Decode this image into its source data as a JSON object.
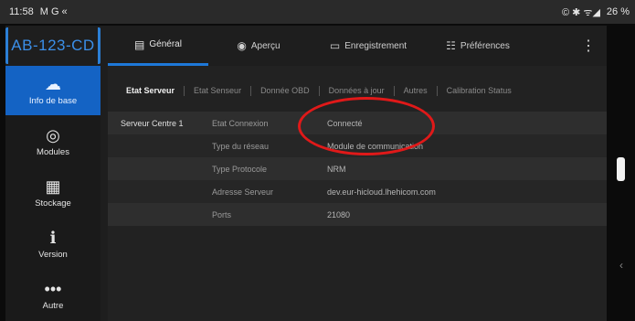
{
  "status_bar": {
    "time": "11:58",
    "left_icons": "M G «",
    "right_icons": "© ✱ ᯤ◢",
    "battery": "26 %"
  },
  "device_id": "AB-123-CD",
  "tabs": [
    {
      "icon": "▤",
      "label": "Général",
      "active": true
    },
    {
      "icon": "◉",
      "label": "Aperçu",
      "active": false
    },
    {
      "icon": "▭",
      "label": "Enregistrement",
      "active": false
    },
    {
      "icon": "☷",
      "label": "Préférences",
      "active": false
    }
  ],
  "menu_icon": "⋮",
  "sidebar": [
    {
      "icon": "☁",
      "label": "Info de base",
      "active": true
    },
    {
      "icon": "◎",
      "label": "Modules",
      "active": false
    },
    {
      "icon": "▦",
      "label": "Stockage",
      "active": false
    },
    {
      "icon": "ℹ",
      "label": "Version",
      "active": false
    },
    {
      "icon": "•••",
      "label": "Autre",
      "active": false
    }
  ],
  "subtabs": [
    "Etat Serveur",
    "Etat Senseur",
    "Donnée OBD",
    "Données à jour",
    "Autres",
    "Calibration Status"
  ],
  "server": {
    "name": "Serveur Centre 1",
    "rows": [
      {
        "label": "Etat Connexion",
        "value": "Connecté"
      },
      {
        "label": "Type du réseau",
        "value": "Module de communication"
      },
      {
        "label": "Type Protocole",
        "value": "NRM"
      },
      {
        "label": "Adresse Serveur",
        "value": "dev.eur-hicloud.lhehicom.com"
      },
      {
        "label": "Ports",
        "value": "21080"
      }
    ]
  },
  "edge_icon": "‹"
}
